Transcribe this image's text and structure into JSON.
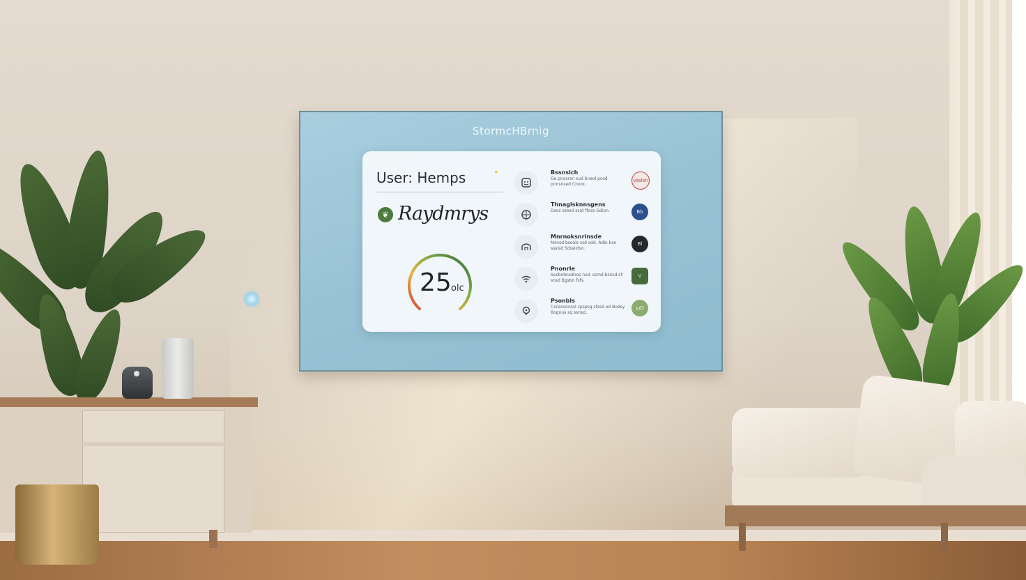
{
  "screen": {
    "title": "StormcHBrnig"
  },
  "panel": {
    "user_label": "User: Hemps",
    "status_icon": "leaf-icon",
    "status_text": "Raydmrys",
    "gauge": {
      "value": "25",
      "unit": "olc",
      "level": 0.75
    }
  },
  "items": [
    {
      "icon": "face-icon",
      "title": "Bssnsich",
      "desc": "Ge pnosrsn sud bnaol posd pnnsnsed Cnnoc.",
      "badge_text": "vsslsn",
      "badge_color": "#f3e8e6",
      "badge_border": "#c0433a"
    },
    {
      "icon": "globe-icon",
      "title": "Thnaglsknnsgens",
      "desc": "Dsos ssesd ssot ffoss Gdion.",
      "badge_text": "Bb",
      "badge_color": "#2d4f8c",
      "badge_border": "#2d4f8c"
    },
    {
      "icon": "home-icon",
      "title": "Mnrnoksnrinsde",
      "desc": "Msnsd bsoals ssd sdd. Adln bsn ssslsd Sdssiidsn.",
      "badge_text": "Bl",
      "badge_color": "#25292b",
      "badge_border": "#25292b"
    },
    {
      "icon": "wifi-icon",
      "title": "Pnonrle",
      "desc": "Sesbnbnsdnos nsd. ssmd bsnsd sf-snsd Bgsbn fsfs.",
      "badge_text": "V",
      "badge_color": "#456b3a",
      "badge_border": "#456b3a"
    },
    {
      "icon": "location-pin-icon",
      "title": "Psonbls",
      "desc": "Csnsnsnnssl cpspsg sfssd od Bodsy Bognus sq ssnsd.",
      "badge_text": "ωD",
      "badge_color": "#8eab6f",
      "badge_border": "#8eab6f"
    }
  ],
  "colors": {
    "screen_bg": "#98c2d4",
    "panel_bg": "#f4f9fb",
    "gauge_gradient": [
      "#d64538",
      "#e8b33c",
      "#7fa84a",
      "#2f6b3a"
    ]
  }
}
